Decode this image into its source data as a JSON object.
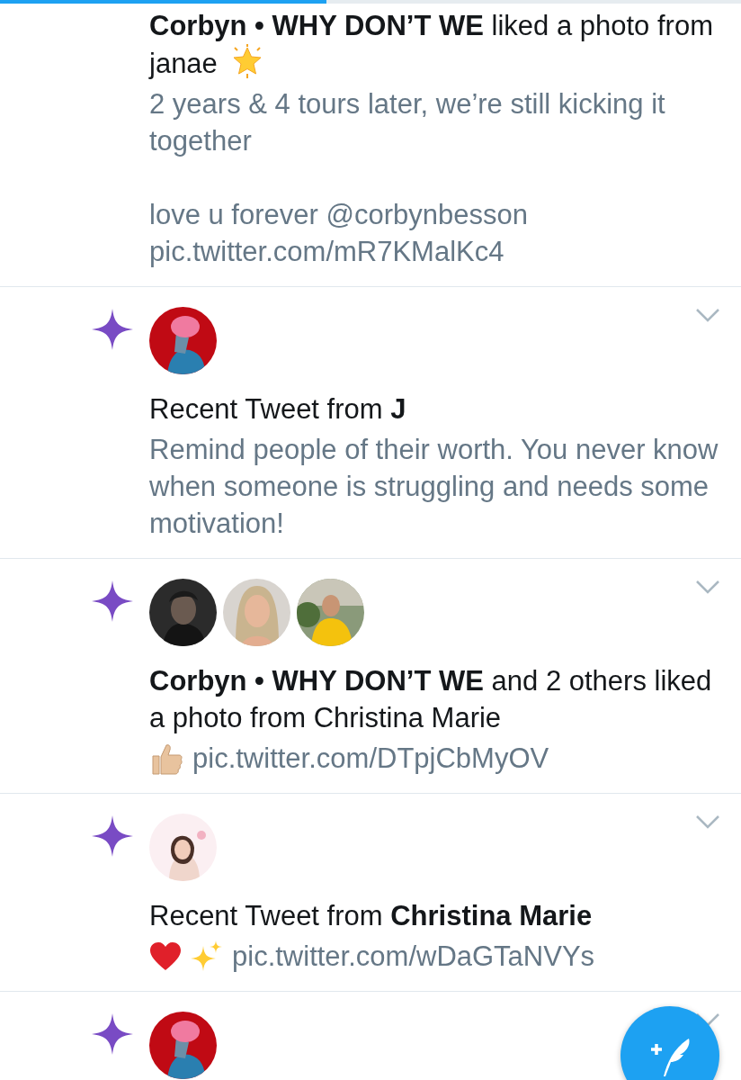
{
  "progress": {
    "level": 0.44
  },
  "notifications": [
    {
      "title": "**Corbyn • WHY DON’T WE** liked a photo from janae",
      "title_icons": [
        {
          "kind": "glowing-star"
        }
      ],
      "body": [
        "2 years & 4 tours later, we’re still kicking it together",
        "love u forever @corbynbesson pic.twitter.com/mR7KMalKc4"
      ]
    },
    {
      "avatars": [
        {
          "kind": "picture"
        }
      ],
      "title": "Recent Tweet from **J**",
      "body": [
        "Remind people of their worth. You never know when someone is struggling and needs some motivation!"
      ]
    },
    {
      "avatars": [
        {
          "kind": "picture"
        },
        {
          "kind": "picture"
        },
        {
          "kind": "picture"
        }
      ],
      "title": "**Corbyn • WHY DON’T WE** and 2 others liked a photo from Christina Marie",
      "body_icons": [
        {
          "kind": "thumbs-up"
        }
      ],
      "body": [
        "pic.twitter.com/DTpjCbMyOV"
      ]
    },
    {
      "avatars": [
        {
          "kind": "picture"
        }
      ],
      "title": "Recent Tweet from **Christina Marie**",
      "body_icons": [
        {
          "kind": "heart"
        },
        {
          "kind": "sparkles"
        }
      ],
      "body": [
        "pic.twitter.com/wDaGTaNVYs"
      ]
    },
    {
      "avatars": [
        {
          "kind": "picture"
        }
      ]
    }
  ]
}
